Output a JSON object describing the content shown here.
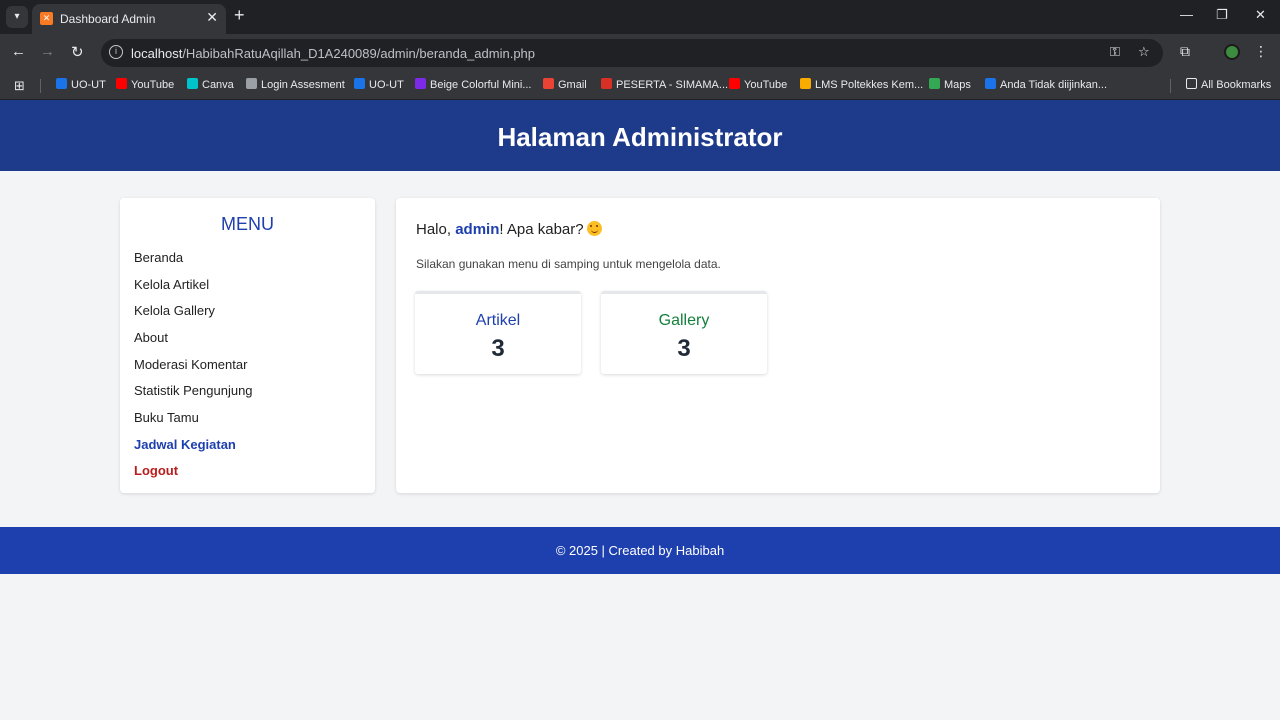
{
  "browser": {
    "tab_title": "Dashboard Admin",
    "url_host": "localhost",
    "url_path": "/HabibahRatuAqillah_D1A240089/admin/beranda_admin.php",
    "bookmarks": [
      {
        "label": "UO-UT",
        "color": "#1a73e8"
      },
      {
        "label": "YouTube",
        "color": "#ff0000"
      },
      {
        "label": "Canva",
        "color": "#00c4cc"
      },
      {
        "label": "Login Assesment",
        "color": "#9aa0a6"
      },
      {
        "label": "UO-UT",
        "color": "#1a73e8"
      },
      {
        "label": "Beige Colorful Mini...",
        "color": "#7d2ae8"
      },
      {
        "label": "Gmail",
        "color": "#ea4335"
      },
      {
        "label": "PESERTA - SIMAMA...",
        "color": "#d93025"
      },
      {
        "label": "YouTube",
        "color": "#ff0000"
      },
      {
        "label": "LMS Poltekkes Kem...",
        "color": "#f9ab00"
      },
      {
        "label": "Maps",
        "color": "#34a853"
      },
      {
        "label": "Anda Tidak diijinkan...",
        "color": "#1a73e8"
      }
    ],
    "all_bookmarks": "All Bookmarks"
  },
  "header": {
    "title": "Halaman Administrator"
  },
  "sidebar": {
    "title": "MENU",
    "items": [
      {
        "label": "Beranda"
      },
      {
        "label": "Kelola Artikel"
      },
      {
        "label": "Kelola Gallery"
      },
      {
        "label": "About"
      },
      {
        "label": "Moderasi Komentar"
      },
      {
        "label": "Statistik Pengunjung"
      },
      {
        "label": "Buku Tamu"
      },
      {
        "label": "Jadwal Kegiatan"
      },
      {
        "label": "Logout"
      }
    ]
  },
  "main": {
    "greeting_prefix": "Halo, ",
    "username": "admin",
    "greeting_suffix": "! Apa kabar?",
    "subtext": "Silakan gunakan menu di samping untuk mengelola data.",
    "cards": [
      {
        "label": "Artikel",
        "value": "3",
        "color": "#1e40af"
      },
      {
        "label": "Gallery",
        "value": "3",
        "color": "#15803d"
      }
    ]
  },
  "footer": {
    "text": "© 2025 | Created by Habibah"
  },
  "colors": {
    "header_bg": "#1e3a8a",
    "footer_bg": "#1e40af",
    "accent": "#1e40af",
    "logout": "#b91c1c"
  }
}
